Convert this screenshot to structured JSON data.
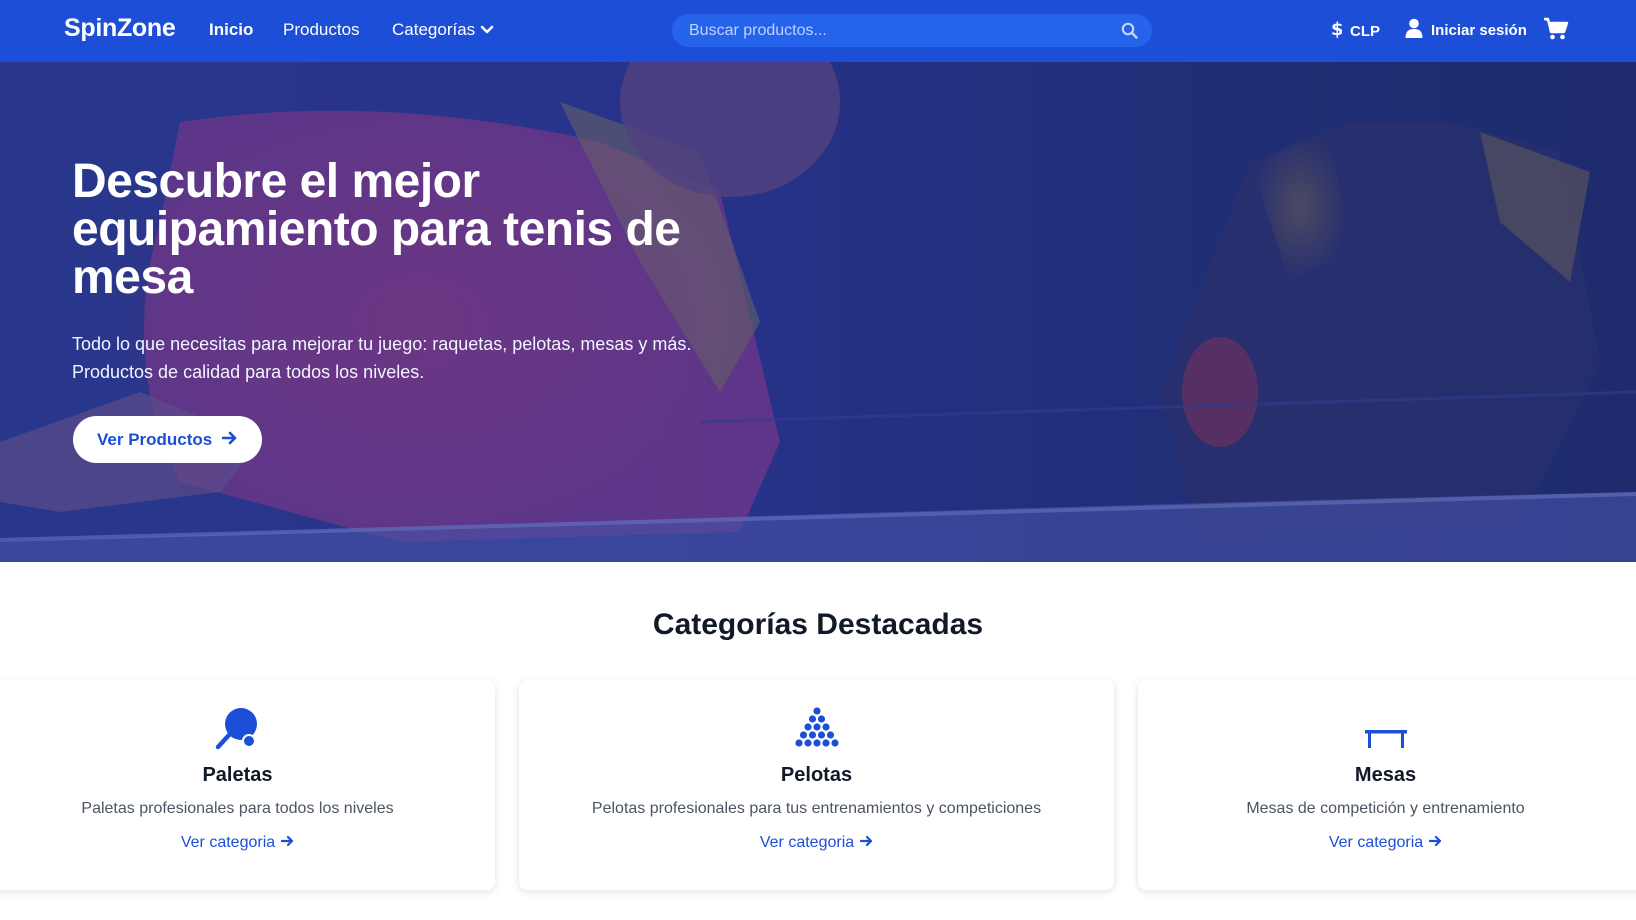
{
  "navbar": {
    "brand": "SpinZone",
    "links": [
      {
        "label": "Inicio"
      },
      {
        "label": "Productos"
      },
      {
        "label": "Categorías"
      }
    ],
    "search": {
      "placeholder": "Buscar productos..."
    },
    "currency": "CLP",
    "login": "Iniciar sesión"
  },
  "hero": {
    "title": "Descubre el mejor equipamiento para tenis de mesa",
    "subtitle_line1": "Todo lo que necesitas para mejorar tu juego: raquetas, pelotas, mesas y más.",
    "subtitle_line2": "Productos de calidad para todos los niveles.",
    "button": "Ver Productos"
  },
  "categories": {
    "title": "Categorías Destacadas",
    "items": [
      {
        "icon": "paddle-icon",
        "title": "Paletas",
        "description": "Paletas profesionales para todos los niveles",
        "link": "Ver categoria"
      },
      {
        "icon": "balls-icon",
        "title": "Pelotas",
        "description": "Pelotas profesionales para tus entrenamientos y competiciones",
        "link": "Ver categoria"
      },
      {
        "icon": "table-icon",
        "title": "Mesas",
        "description": "Mesas de competición y entrenamiento",
        "link": "Ver categoria"
      }
    ]
  },
  "colors": {
    "primary": "#1d4ed8",
    "search_bg": "#2563eb",
    "hero_overlay": "#2a358a"
  }
}
